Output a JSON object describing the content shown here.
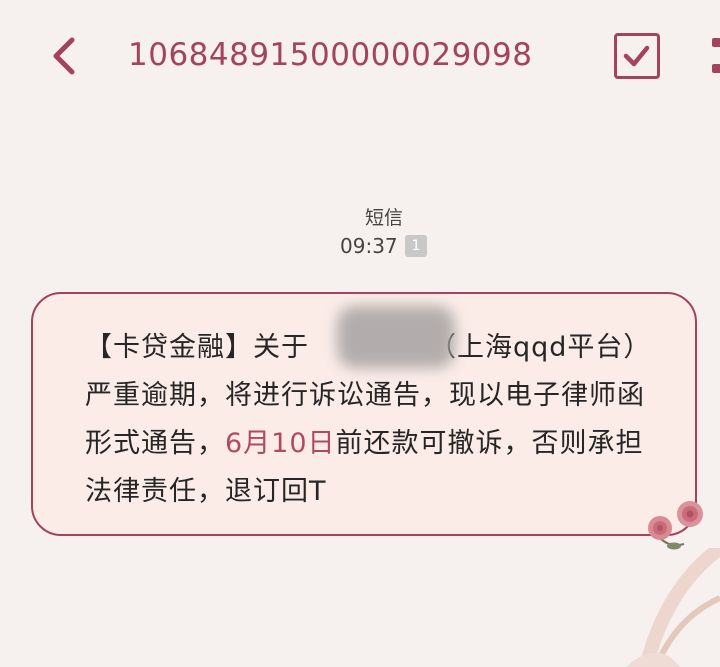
{
  "header": {
    "title": "10684891500000029098",
    "back_icon": "chevron-left-icon",
    "check_icon": "check-square-icon",
    "more_icon": "more-vertical-icon"
  },
  "meta": {
    "channel": "短信",
    "time": "09:37",
    "sim_badge": "1"
  },
  "message": {
    "part1": "【卡贷金融】关于",
    "part2": "（上海qqd平台）严重逾期，将进行诉讼通告，现以电子律师函形式通告，",
    "date": "6月10日",
    "part3": "前还款可撤诉，否则承担法律责任，退订回T"
  },
  "colors": {
    "accent": "#a3445f",
    "bubble_bg": "#fbece8",
    "page_bg": "#f6f1ee",
    "date_highlight": "#b04a63"
  }
}
